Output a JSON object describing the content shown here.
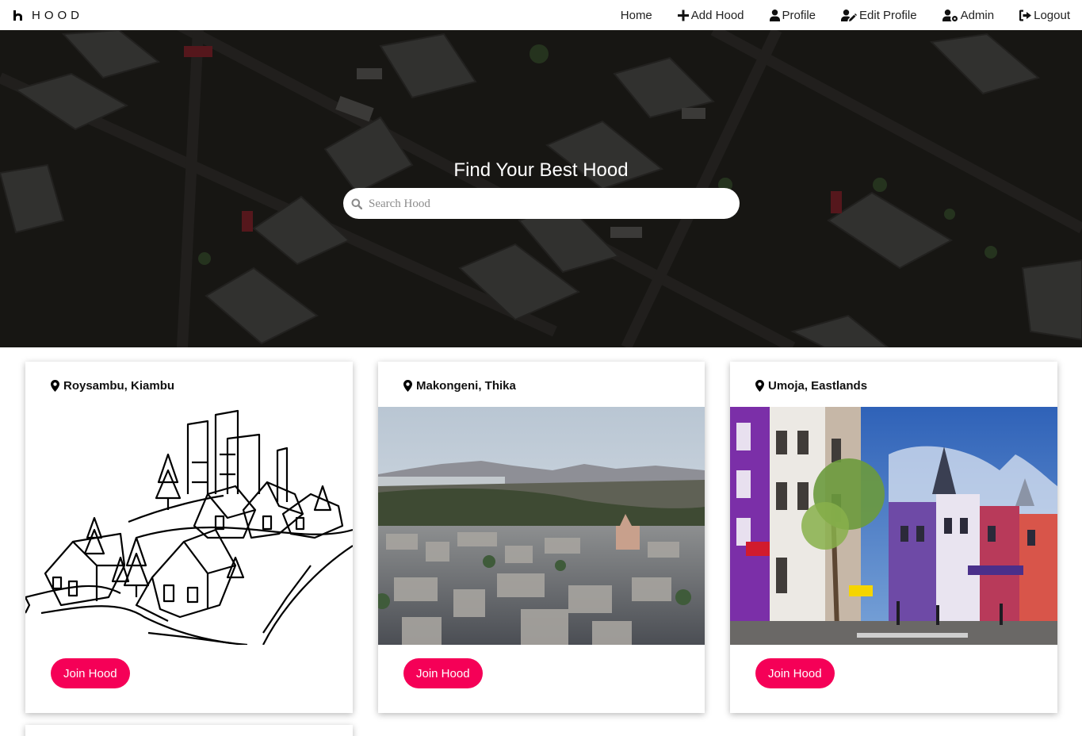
{
  "brand": {
    "name": "HOOD",
    "icon": "h-logo-icon"
  },
  "nav": {
    "items": [
      {
        "label": "Home",
        "icon": ""
      },
      {
        "label": "Add Hood",
        "icon": "plus-icon"
      },
      {
        "label": "Profile",
        "icon": "user-icon"
      },
      {
        "label": "Edit Profile",
        "icon": "user-edit-icon"
      },
      {
        "label": "Admin",
        "icon": "user-cog-icon"
      },
      {
        "label": "Logout",
        "icon": "sign-out-icon"
      }
    ]
  },
  "hero": {
    "title": "Find Your Best Hood",
    "search_placeholder": "Search Hood",
    "search_value": ""
  },
  "cards": [
    {
      "location": "Roysambu, Kiambu",
      "button": "Join Hood",
      "image": "line-drawing-of-neighborhood"
    },
    {
      "location": "Makongeni, Thika",
      "button": "Join Hood",
      "image": "aerial-city-photo"
    },
    {
      "location": "Umoja, Eastlands",
      "button": "Join Hood",
      "image": "colorful-street-photo"
    }
  ],
  "colors": {
    "accent": "#f50057",
    "navbar_bg": "#ffffff"
  }
}
